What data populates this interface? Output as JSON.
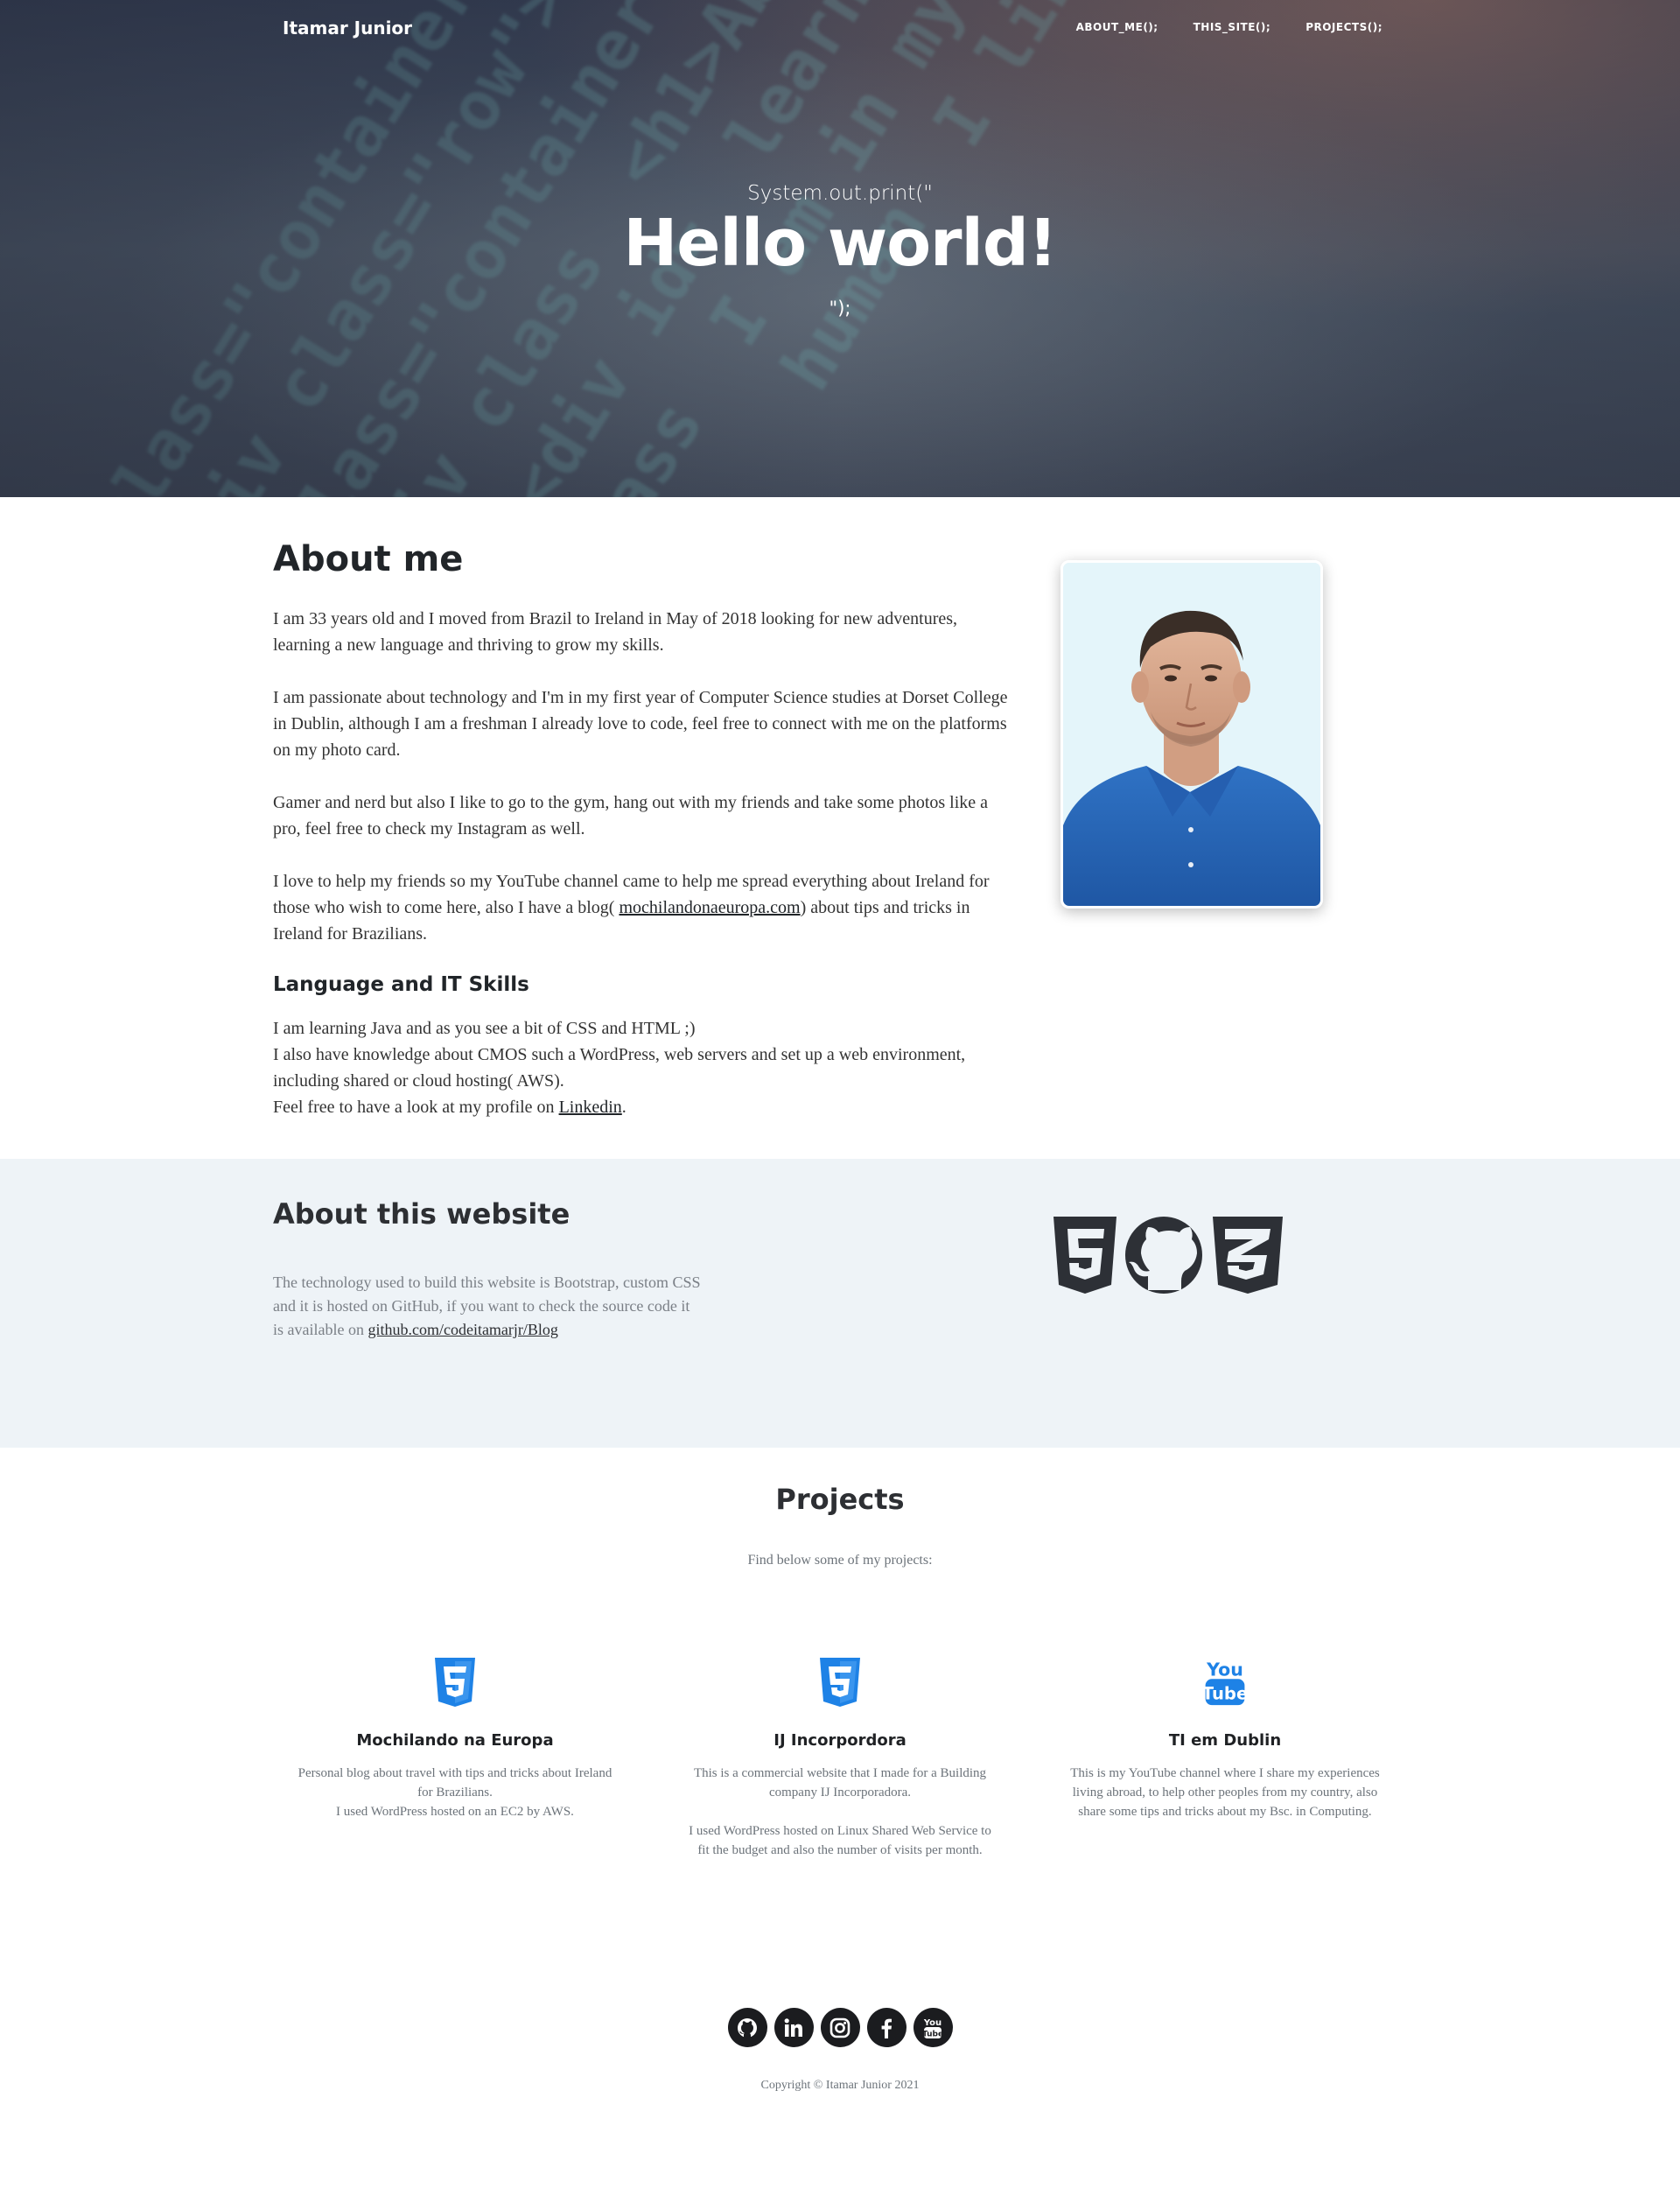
{
  "nav": {
    "brand": "Itamar Junior",
    "links": [
      "ABOUT_ME();",
      "THIS_SITE();",
      "PROJECTS();"
    ]
  },
  "hero": {
    "pre": "System.out.print(\"",
    "title": "Hello world!",
    "post": "\");"
  },
  "about": {
    "title": "About me",
    "p1": "I am 33 years old and I moved from Brazil to Ireland in May of 2018 looking for new adventures, learning a new language and thriving to grow my skills.",
    "p2": "I am passionate about technology and I'm in my first year of Computer Science studies at Dorset College in Dublin, although I am a freshman I already love to code, feel free to connect with me on the platforms on my photo card.",
    "p3": "Gamer and nerd but also I like to go to the gym, hang out with my friends and take some photos like a pro, feel free to check my Instagram as well.",
    "p4_before": "I love to help my friends so my YouTube channel came to help me spread everything about Ireland for those who wish to come here, also I have a blog( ",
    "p4_link": "mochilandonaeuropa.com",
    "p4_after": ") about tips and tricks in Ireland for Brazilians.",
    "skills_title": "Language and IT Skills",
    "skills_l1": "I am learning Java and as you see a bit of CSS and HTML ;)",
    "skills_l2": "I also have knowledge about CMOS such a WordPress, web servers and set up a web environment, including shared or cloud hosting( AWS).",
    "skills_l3_before": "Feel free to have a look at my profile on ",
    "skills_l3_link": "Linkedin",
    "skills_l3_after": "."
  },
  "site": {
    "title": "About this website",
    "text": "The technology used to build this website is Bootstrap, custom CSS and it is hosted on GitHub, if you want to check the source code it is available on ",
    "link": "github.com/codeitamarjr/Blog"
  },
  "projects": {
    "title": "Projects",
    "subtitle": "Find below some of my projects:",
    "items": [
      {
        "icon": "html5-icon",
        "title": "Mochilando na Europa",
        "l1": "Personal blog about travel with tips and tricks about Ireland for Brazilians.",
        "l2": "I used WordPress hosted on an EC2 by AWS."
      },
      {
        "icon": "html5-icon",
        "title": "IJ Incorpordora",
        "l1": "This is a commercial website that I made for a Building company IJ Incorporadora.",
        "l2": "I used WordPress hosted on Linux Shared Web Service to fit the budget and also the number of visits per month."
      },
      {
        "icon": "youtube-icon",
        "title": "TI em Dublin",
        "l1": "This is my YouTube channel where I share my experiences living abroad, to help other peoples from my country, also share some tips and tricks about my Bsc. in Computing.",
        "l2": ""
      }
    ]
  },
  "footer": {
    "socials": [
      "github-icon",
      "linkedin-icon",
      "instagram-icon",
      "facebook-icon",
      "youtube-icon"
    ],
    "copyright": "Copyright © Itamar Junior 2021"
  },
  "colors": {
    "accent_blue": "#1e82e6",
    "dark": "#1b1c1f",
    "section_bg": "#eef3f7"
  }
}
